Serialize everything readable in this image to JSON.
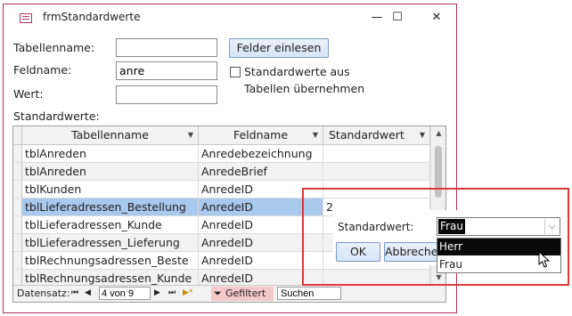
{
  "window": {
    "title": "frmStandardwerte",
    "minimize": "—",
    "maximize": "☐",
    "close": "✕"
  },
  "form": {
    "tabellenname_label": "Tabellenname:",
    "tabellenname_value": "",
    "feldname_label": "Feldname:",
    "feldname_value": "anre",
    "wert_label": "Wert:",
    "wert_value": "",
    "felder_button": "Felder einlesen",
    "checkbox_label_1": "Standardwerte aus",
    "checkbox_label_2": "Tabellen übernehmen",
    "checkbox_checked": false,
    "standardwerte_label": "Standardwerte:"
  },
  "grid": {
    "headers": [
      "Tabellenname",
      "Feldname",
      "Standardwert"
    ],
    "rows": [
      [
        "tblAnreden",
        "Anredebezeichnung",
        ""
      ],
      [
        "tblAnreden",
        "AnredeBrief",
        ""
      ],
      [
        "tblKunden",
        "AnredeID",
        ""
      ],
      [
        "tblLieferadressen_Bestellung",
        "AnredeID",
        "2"
      ],
      [
        "tblLieferadressen_Kunde",
        "AnredeID",
        ""
      ],
      [
        "tblLieferadressen_Lieferung",
        "AnredeID",
        ""
      ],
      [
        "tblRechnungsadressen_Beste",
        "AnredeID",
        ""
      ],
      [
        "tblRechnungsadressen_Kunde",
        "AnredeID",
        ""
      ]
    ],
    "selected_row_index": 3
  },
  "navbar": {
    "label": "Datensatz:",
    "first": "⏮",
    "prev": "◀",
    "position": "4 von 9",
    "next": "▶",
    "last": "⏭",
    "new": "▶*",
    "filter": "Gefiltert",
    "search_placeholder": "Suchen"
  },
  "popup": {
    "label": "Standardwert:",
    "selected_value": "Frau",
    "ok": "OK",
    "cancel": "Abbrechen",
    "options": [
      "Herr",
      "Frau"
    ],
    "highlighted_option": "Herr"
  },
  "colors": {
    "highlight": "#a8c8ec",
    "annotation": "#e03838",
    "window_border": "#b03060"
  }
}
